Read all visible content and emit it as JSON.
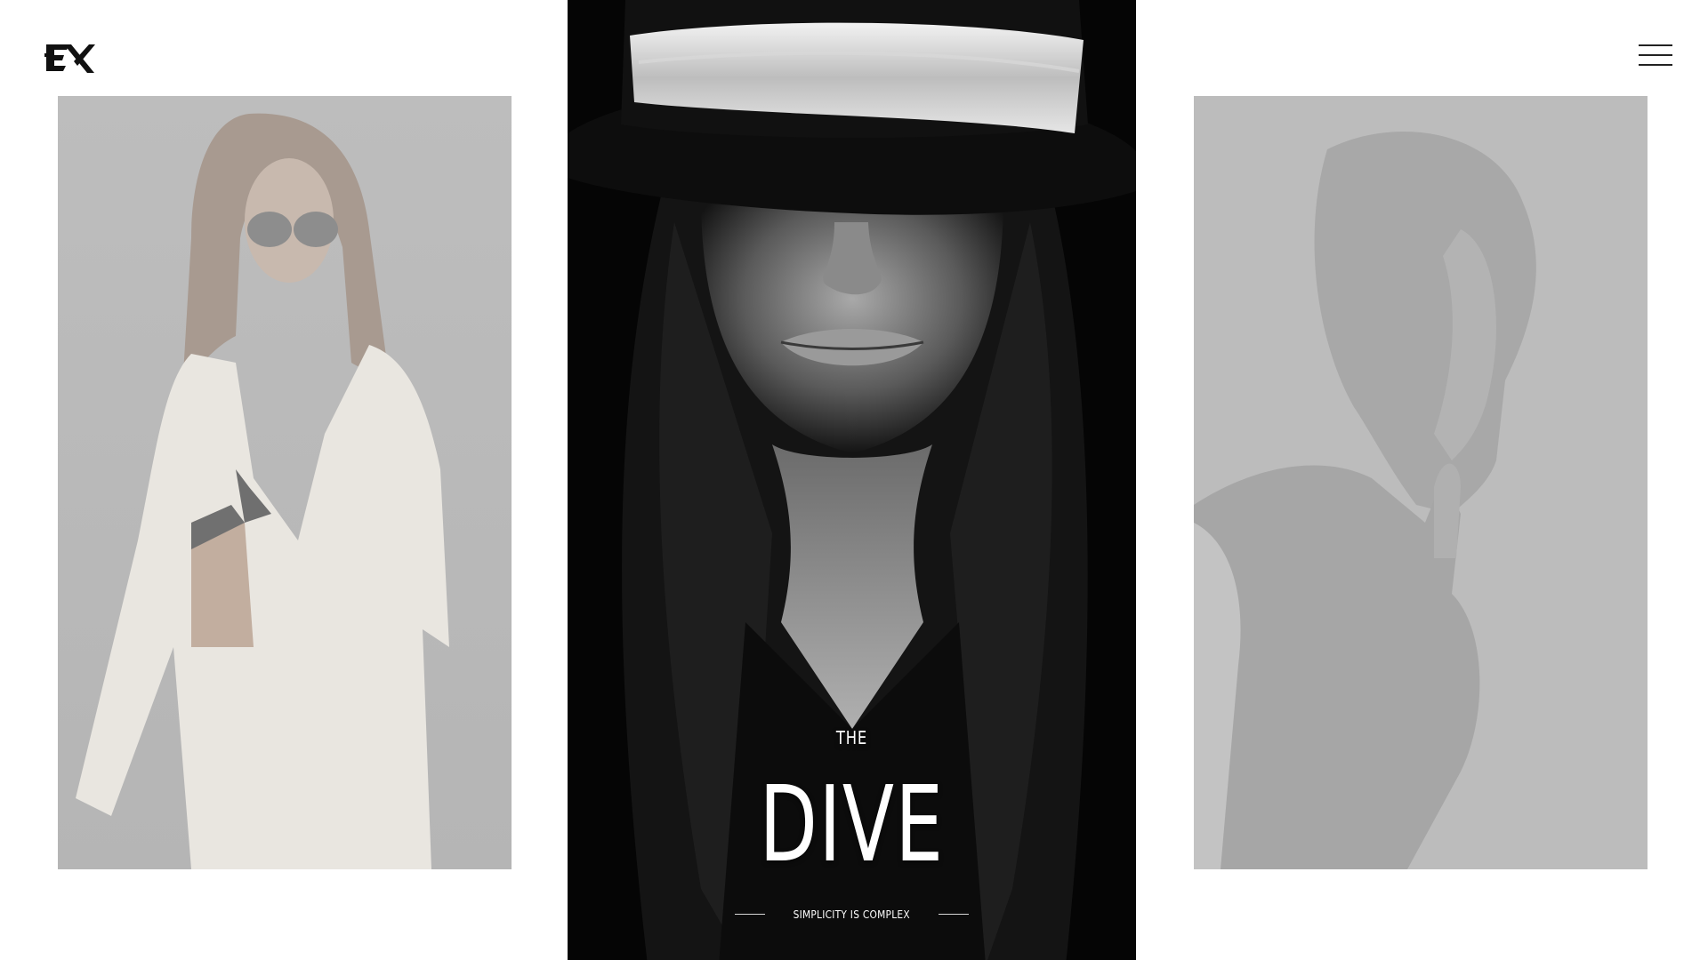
{
  "brand": {
    "logo_text": "EX"
  },
  "header": {
    "menu_icon": "hamburger-menu-icon"
  },
  "slides": {
    "left": {
      "description_icon": "fashion-model-white-suit-image"
    },
    "center": {
      "pre_title": "THE",
      "title": "DIVE",
      "tagline": "SIMPLICITY IS COMPLEX"
    },
    "right": {
      "description_icon": "woman-portrait-image"
    }
  },
  "colors": {
    "background": "#ffffff",
    "center_panel": "#050505",
    "side_panel_tint": "#b9b9b9",
    "text_light": "#ffffff",
    "icon_dark": "#222222"
  }
}
